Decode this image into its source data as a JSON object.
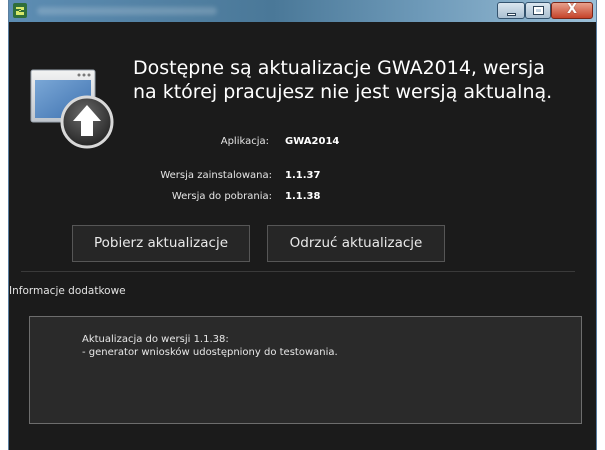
{
  "window": {
    "icon": "app-logo-icon",
    "controls": {
      "minimize": "minimize-icon",
      "maximize": "maximize-icon",
      "close_label": "X"
    }
  },
  "headline": {
    "line1": "Dostępne są aktualizacje GWA2014, wersja",
    "line2": "na której pracujesz nie jest wersją aktualną."
  },
  "update_icon": "download-arrow-icon",
  "details": {
    "app_label": "Aplikacja:",
    "app_value": "GWA2014",
    "installed_label": "Wersja zainstalowana:",
    "installed_value": "1.1.37",
    "available_label": "Wersja do pobrania:",
    "available_value": "1.1.38"
  },
  "buttons": {
    "download": "Pobierz aktualizacje",
    "reject": "Odrzuć aktualizacje"
  },
  "additional": {
    "title": "Informacje dodatkowe",
    "notes": [
      "Aktualizacja do wersji 1.1.38:",
      "- generator wniosków udostępniony do testowania."
    ]
  },
  "colors": {
    "background": "#1b1b1b",
    "titlebar": "#5d8db3",
    "close_button": "#c5432a",
    "text": "#ffffff"
  }
}
